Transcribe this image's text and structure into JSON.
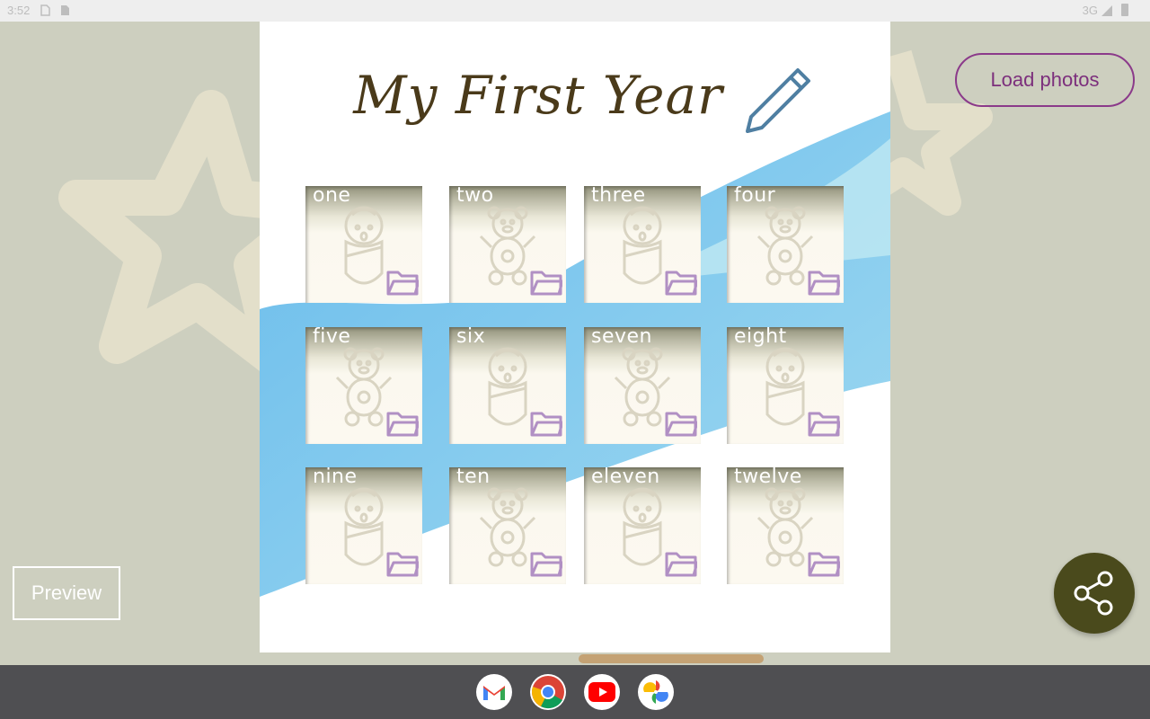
{
  "status_bar": {
    "time": "3:52",
    "network": "3G"
  },
  "page": {
    "title": "My First Year"
  },
  "tiles": [
    {
      "label": "one",
      "figure": "baby"
    },
    {
      "label": "two",
      "figure": "bear"
    },
    {
      "label": "three",
      "figure": "baby"
    },
    {
      "label": "four",
      "figure": "bear"
    },
    {
      "label": "five",
      "figure": "bear"
    },
    {
      "label": "six",
      "figure": "baby"
    },
    {
      "label": "seven",
      "figure": "bear"
    },
    {
      "label": "eight",
      "figure": "baby"
    },
    {
      "label": "nine",
      "figure": "baby"
    },
    {
      "label": "ten",
      "figure": "bear"
    },
    {
      "label": "eleven",
      "figure": "baby"
    },
    {
      "label": "twelve",
      "figure": "bear"
    }
  ],
  "buttons": {
    "load_photos": "Load photos",
    "preview": "Preview"
  },
  "dock": {
    "apps": [
      "Gmail",
      "Chrome",
      "YouTube",
      "Photos"
    ]
  },
  "colors": {
    "background": "#cdcfbf",
    "accent_purple": "#8b3a8a",
    "fab": "#4a4a1c",
    "title": "#4a3a1a"
  },
  "icons": {
    "edit": "pencil-icon",
    "tile_action": "folder-icon",
    "share": "share-icon"
  }
}
